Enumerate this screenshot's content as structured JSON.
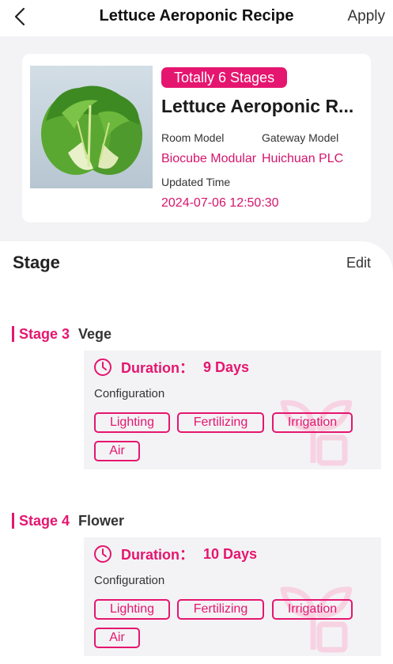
{
  "header": {
    "title": "Lettuce Aeroponic Recipe",
    "apply_label": "Apply"
  },
  "recipe": {
    "badge": "Totally 6 Stages",
    "name": "Lettuce Aeroponic R...",
    "room_model_label": "Room Model",
    "room_model_value": "Biocube Modular",
    "gateway_model_label": "Gateway Model",
    "gateway_model_value": "Huichuan PLC",
    "updated_label": "Updated Time",
    "updated_value": "2024-07-06 12:50:30"
  },
  "stage_section": {
    "heading": "Stage",
    "edit_label": "Edit"
  },
  "stages": [
    {
      "number": "Stage 3",
      "name": "Vege",
      "duration_label": "Duration：",
      "duration_value": "9 Days",
      "config_label": "Configuration",
      "chips": [
        "Lighting",
        "Fertilizing",
        "Irrigation",
        "Air"
      ]
    },
    {
      "number": "Stage 4",
      "name": "Flower",
      "duration_label": "Duration：",
      "duration_value": "10 Days",
      "config_label": "Configuration",
      "chips": [
        "Lighting",
        "Fertilizing",
        "Irrigation",
        "Air"
      ]
    }
  ],
  "colors": {
    "accent": "#e5166f",
    "background": "#f3f3f5",
    "card": "#ffffff"
  },
  "icons": {
    "back": "chevron-left-icon",
    "clock": "clock-icon",
    "watermark": "leaf-logo-icon"
  }
}
